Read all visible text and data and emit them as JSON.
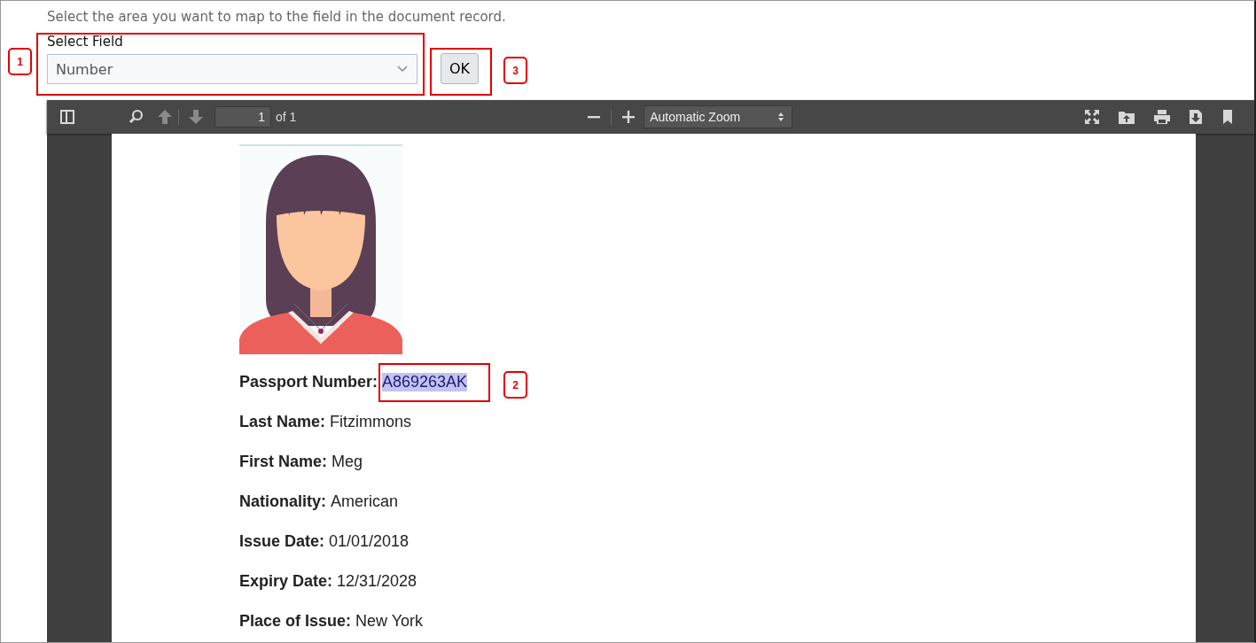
{
  "instruction": "Select the area you want to map to the field in the document record.",
  "select_field": {
    "label": "Select Field",
    "value": "Number"
  },
  "ok_button": "OK",
  "viewer": {
    "toolbar": {
      "page_number": "1",
      "page_count": "of 1",
      "zoom": "Automatic Zoom"
    },
    "document": {
      "fields": [
        {
          "label": "Passport Number:",
          "value": "A869263AK",
          "selected": true
        },
        {
          "label": "Last Name:",
          "value": "Fitzimmons",
          "selected": false
        },
        {
          "label": "First Name:",
          "value": "Meg",
          "selected": false
        },
        {
          "label": "Nationality:",
          "value": "American",
          "selected": false
        },
        {
          "label": "Issue Date:",
          "value": "01/01/2018",
          "selected": false
        },
        {
          "label": "Expiry Date:",
          "value": "12/31/2028",
          "selected": false
        },
        {
          "label": "Place of Issue:",
          "value": "New York",
          "selected": false
        }
      ]
    }
  },
  "callouts": [
    {
      "number": "1"
    },
    {
      "number": "2"
    },
    {
      "number": "3"
    }
  ]
}
